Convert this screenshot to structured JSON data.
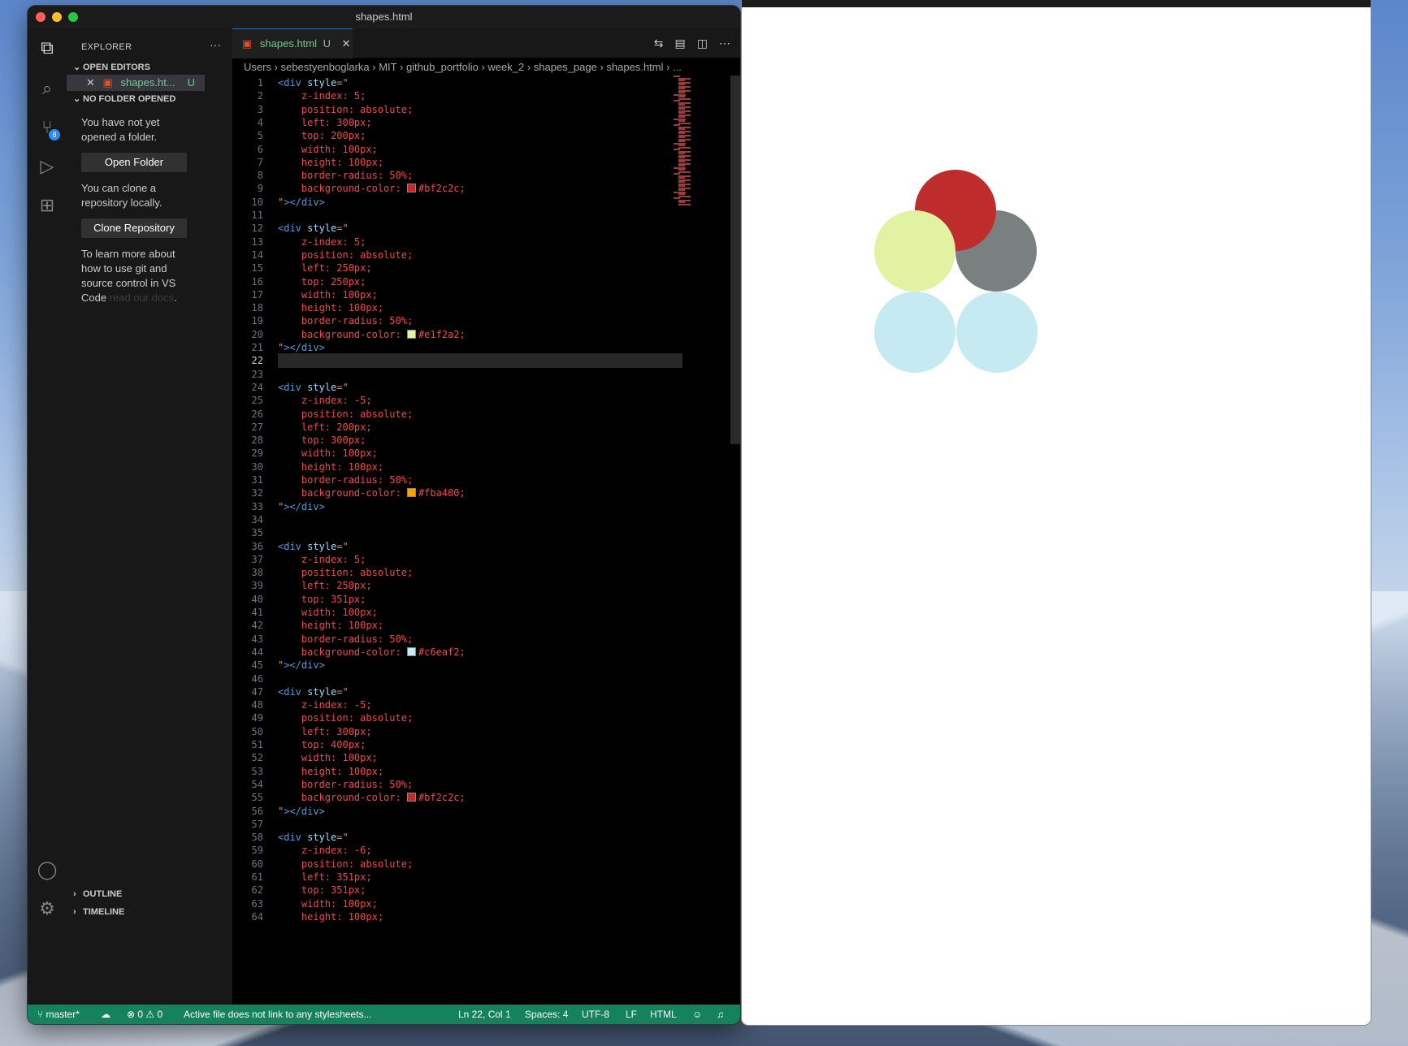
{
  "window": {
    "title": "shapes.html"
  },
  "activity": {
    "scm_badge": "8"
  },
  "sidebar": {
    "title": "EXPLORER",
    "more": "···",
    "open_editors_label": "OPEN EDITORS",
    "open_editor_item": "shapes.ht...",
    "open_editor_status": "U",
    "no_folder_label": "NO FOLDER OPENED",
    "msg1": "You have not yet opened a folder.",
    "open_folder_button": "Open Folder",
    "msg2": "You can clone a repository locally.",
    "clone_button": "Clone Repository",
    "msg3": "To learn more about how to use git and source control in VS Code",
    "msg3_link": "read our docs",
    "msg3_end": ".",
    "outline_label": "OUTLINE",
    "timeline_label": "TIMELINE"
  },
  "tab": {
    "label": "shapes.html",
    "status": "U"
  },
  "breadcrumb": [
    "Users",
    "sebestyenboglarka",
    "MIT",
    "github_portfolio",
    "week_2",
    "shapes_page",
    "shapes.html",
    "..."
  ],
  "editor": {
    "current_line": 22,
    "lines": [
      {
        "n": 1,
        "t": "<div style=\""
      },
      {
        "n": 2,
        "t": "    z-index: 5;"
      },
      {
        "n": 3,
        "t": "    position: absolute;"
      },
      {
        "n": 4,
        "t": "    left: 300px;"
      },
      {
        "n": 5,
        "t": "    top: 200px;"
      },
      {
        "n": 6,
        "t": "    width: 100px;"
      },
      {
        "n": 7,
        "t": "    height: 100px;"
      },
      {
        "n": 8,
        "t": "    border-radius: 50%;"
      },
      {
        "n": 9,
        "t": "    background-color: ",
        "c": "#bf2c2c"
      },
      {
        "n": 10,
        "t": "\"></div>"
      },
      {
        "n": 11,
        "t": ""
      },
      {
        "n": 12,
        "t": "<div style=\""
      },
      {
        "n": 13,
        "t": "    z-index: 5;"
      },
      {
        "n": 14,
        "t": "    position: absolute;"
      },
      {
        "n": 15,
        "t": "    left: 250px;"
      },
      {
        "n": 16,
        "t": "    top: 250px;"
      },
      {
        "n": 17,
        "t": "    width: 100px;"
      },
      {
        "n": 18,
        "t": "    height: 100px;"
      },
      {
        "n": 19,
        "t": "    border-radius: 50%;"
      },
      {
        "n": 20,
        "t": "    background-color: ",
        "c": "#e1f2a2"
      },
      {
        "n": 21,
        "t": "\"></div>"
      },
      {
        "n": 22,
        "t": ""
      },
      {
        "n": 23,
        "t": ""
      },
      {
        "n": 24,
        "t": "<div style=\""
      },
      {
        "n": 25,
        "t": "    z-index: -5;"
      },
      {
        "n": 26,
        "t": "    position: absolute;"
      },
      {
        "n": 27,
        "t": "    left: 200px;"
      },
      {
        "n": 28,
        "t": "    top: 300px;"
      },
      {
        "n": 29,
        "t": "    width: 100px;"
      },
      {
        "n": 30,
        "t": "    height: 100px;"
      },
      {
        "n": 31,
        "t": "    border-radius: 50%;"
      },
      {
        "n": 32,
        "t": "    background-color: ",
        "c": "#fba400"
      },
      {
        "n": 33,
        "t": "\"></div>"
      },
      {
        "n": 34,
        "t": ""
      },
      {
        "n": 35,
        "t": ""
      },
      {
        "n": 36,
        "t": "<div style=\""
      },
      {
        "n": 37,
        "t": "    z-index: 5;"
      },
      {
        "n": 38,
        "t": "    position: absolute;"
      },
      {
        "n": 39,
        "t": "    left: 250px;"
      },
      {
        "n": 40,
        "t": "    top: 351px;"
      },
      {
        "n": 41,
        "t": "    width: 100px;"
      },
      {
        "n": 42,
        "t": "    height: 100px;"
      },
      {
        "n": 43,
        "t": "    border-radius: 50%;"
      },
      {
        "n": 44,
        "t": "    background-color: ",
        "c": "#c6eaf2"
      },
      {
        "n": 45,
        "t": "\"></div>"
      },
      {
        "n": 46,
        "t": ""
      },
      {
        "n": 47,
        "t": "<div style=\""
      },
      {
        "n": 48,
        "t": "    z-index: -5;"
      },
      {
        "n": 49,
        "t": "    position: absolute;"
      },
      {
        "n": 50,
        "t": "    left: 300px;"
      },
      {
        "n": 51,
        "t": "    top: 400px;"
      },
      {
        "n": 52,
        "t": "    width: 100px;"
      },
      {
        "n": 53,
        "t": "    height: 100px;"
      },
      {
        "n": 54,
        "t": "    border-radius: 50%;"
      },
      {
        "n": 55,
        "t": "    background-color: ",
        "c": "#bf2c2c"
      },
      {
        "n": 56,
        "t": "\"></div>"
      },
      {
        "n": 57,
        "t": ""
      },
      {
        "n": 58,
        "t": "<div style=\""
      },
      {
        "n": 59,
        "t": "    z-index: -6;"
      },
      {
        "n": 60,
        "t": "    position: absolute;"
      },
      {
        "n": 61,
        "t": "    left: 351px;"
      },
      {
        "n": 62,
        "t": "    top: 351px;"
      },
      {
        "n": 63,
        "t": "    width: 100px;"
      },
      {
        "n": 64,
        "t": "    height: 100px;"
      }
    ]
  },
  "statusbar": {
    "branch": "master*",
    "errors": "0",
    "warnings": "0",
    "message": "Active file does not link to any stylesheets...",
    "position": "Ln 22, Col 1",
    "spaces": "Spaces: 4",
    "encoding": "UTF-8",
    "eol": "LF",
    "language": "HTML"
  },
  "preview": {
    "circles": [
      {
        "color": "#bf2c2c"
      },
      {
        "color": "#e1f2a2"
      },
      {
        "color": "#fba400"
      },
      {
        "color": "#c6eaf2"
      },
      {
        "color": "#bf2c2c"
      },
      {
        "color": "#fba400"
      },
      {
        "color": "#c6eaf2"
      },
      {
        "color": "#7a7f80"
      }
    ]
  }
}
